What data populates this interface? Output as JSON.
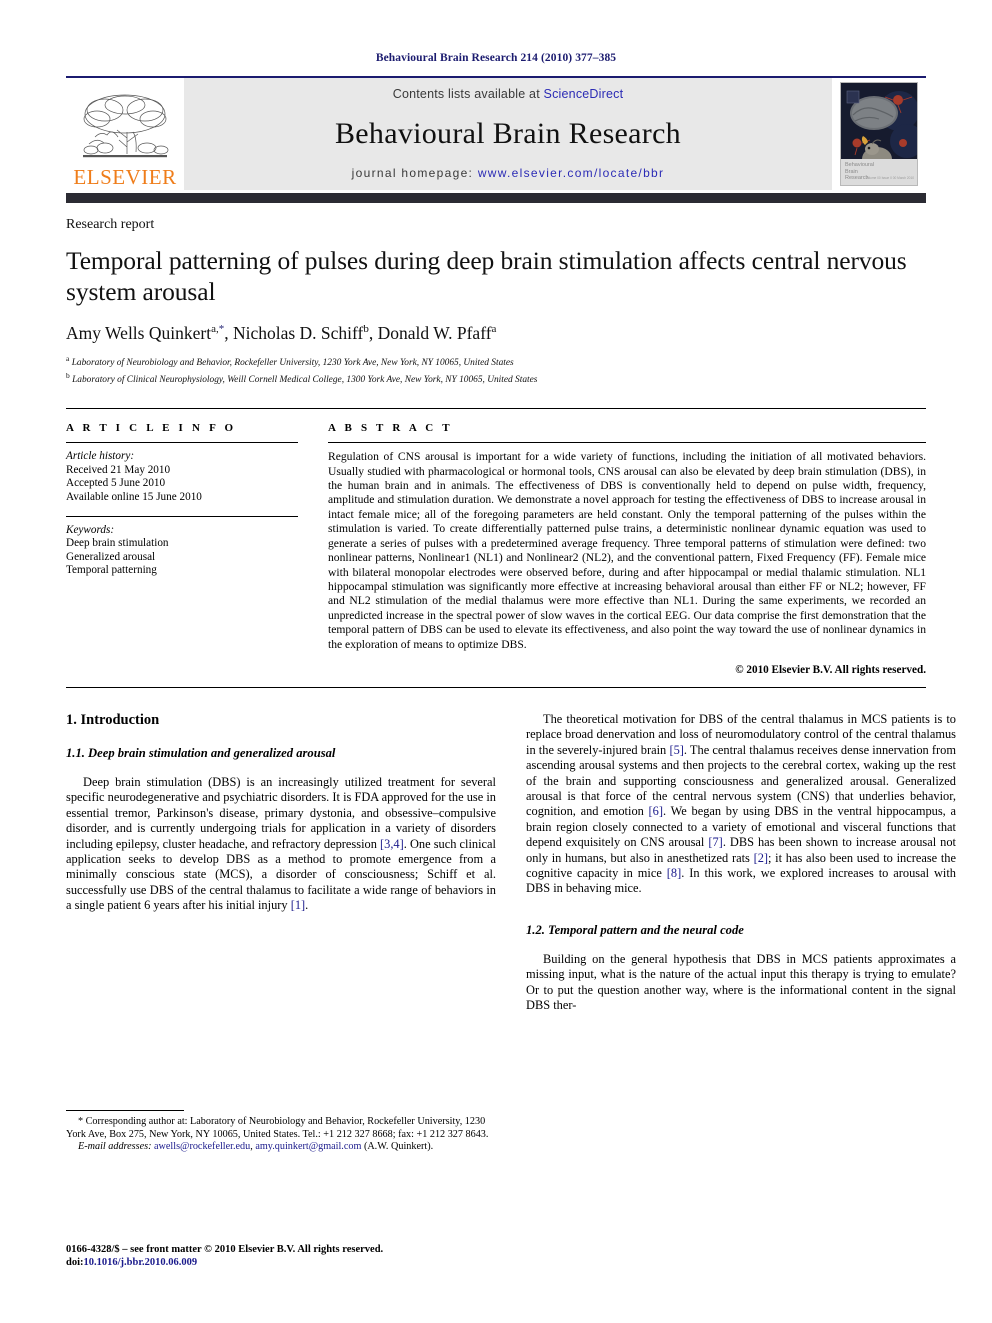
{
  "running_head": "Behavioural Brain Research 214 (2010) 377–385",
  "masthead": {
    "publisher": "ELSEVIER",
    "contents_prefix": "Contents lists available at ",
    "contents_link": "ScienceDirect",
    "journal_title": "Behavioural Brain Research",
    "homepage_prefix": "journal homepage: ",
    "homepage_url": "www.elsevier.com/locate/bbr",
    "cover_caption_line1": "Behavioural",
    "cover_caption_line2": "Brain",
    "cover_caption_line3": "Research",
    "cover_caption_tiny": "Volume 00  Issue 0  00 March 2010",
    "brand_orange": "#ef7d1a",
    "brand_navy": "#1b1b6f"
  },
  "article": {
    "kicker": "Research report",
    "title": "Temporal patterning of pulses during deep brain stimulation affects central nervous system arousal",
    "authors_html": "Amy Wells Quinkert<sup>a,<span class=\"star\">*</span></sup>, Nicholas D. Schiff<sup>b</sup>, Donald W. Pfaff<sup>a</sup>",
    "affiliations": [
      {
        "marker": "a",
        "text": "Laboratory of Neurobiology and Behavior, Rockefeller University, 1230 York Ave, New York, NY 10065, United States"
      },
      {
        "marker": "b",
        "text": "Laboratory of Clinical Neurophysiology, Weill Cornell Medical College, 1300 York Ave, New York, NY 10065, United States"
      }
    ]
  },
  "article_info": {
    "label": "A R T I C L E    I N F O",
    "history_heading": "Article history:",
    "history": [
      "Received 21 May 2010",
      "Accepted 5 June 2010",
      "Available online 15 June 2010"
    ],
    "keywords_heading": "Keywords:",
    "keywords": [
      "Deep brain stimulation",
      "Generalized arousal",
      "Temporal patterning"
    ]
  },
  "abstract": {
    "label": "A B S T R A C T",
    "text": "Regulation of CNS arousal is important for a wide variety of functions, including the initiation of all motivated behaviors. Usually studied with pharmacological or hormonal tools, CNS arousal can also be elevated by deep brain stimulation (DBS), in the human brain and in animals. The effectiveness of DBS is conventionally held to depend on pulse width, frequency, amplitude and stimulation duration. We demonstrate a novel approach for testing the effectiveness of DBS to increase arousal in intact female mice; all of the foregoing parameters are held constant. Only the temporal patterning of the pulses within the stimulation is varied. To create differentially patterned pulse trains, a deterministic nonlinear dynamic equation was used to generate a series of pulses with a predetermined average frequency. Three temporal patterns of stimulation were defined: two nonlinear patterns, Nonlinear1 (NL1) and Nonlinear2 (NL2), and the conventional pattern, Fixed Frequency (FF). Female mice with bilateral monopolar electrodes were observed before, during and after hippocampal or medial thalamic stimulation. NL1 hippocampal stimulation was significantly more effective at increasing behavioral arousal than either FF or NL2; however, FF and NL2 stimulation of the medial thalamus were more effective than NL1. During the same experiments, we recorded an unpredicted increase in the spectral power of slow waves in the cortical EEG. Our data comprise the first demonstration that the temporal pattern of DBS can be used to elevate its effectiveness, and also point the way toward the use of nonlinear dynamics in the exploration of means to optimize DBS.",
    "copyright": "© 2010 Elsevier B.V. All rights reserved."
  },
  "body": {
    "left": {
      "h1": "1.  Introduction",
      "h2": "1.1.  Deep brain stimulation and generalized arousal",
      "para_1a": "Deep brain stimulation (DBS) is an increasingly utilized treatment for several specific neurodegenerative and psychiatric disorders. It is FDA approved for the use in essential tremor, Parkinson's disease, primary dystonia, and obsessive–compulsive disorder, and is currently undergoing trials for application in a variety of disorders including epilepsy, cluster headache, and refractory depression ",
      "ref_34": "[3,4]",
      "para_1b": ". One such clinical application seeks to develop DBS as a method to promote emergence from a minimally conscious state (MCS), a disorder of consciousness; Schiff et al. successfully use DBS of the central thalamus to facilitate a wide range of behaviors in a single patient 6 years after his initial injury ",
      "ref_1": "[1]",
      "para_1c": "."
    },
    "right": {
      "para_2a": "The theoretical motivation for DBS of the central thalamus in MCS patients is to replace broad denervation and loss of neuromodulatory control of the central thalamus in the severely-injured brain ",
      "ref_5": "[5]",
      "para_2b": ". The central thalamus receives dense innervation from ascending arousal systems and then projects to the cerebral cortex, waking up the rest of the brain and supporting consciousness and generalized arousal. Generalized arousal is that force of the central nervous system (CNS) that underlies behavior, cognition, and emotion ",
      "ref_6": "[6]",
      "para_2c": ". We began by using DBS in the ventral hippocampus, a brain region closely connected to a variety of emotional and visceral functions that depend exquisitely on CNS arousal ",
      "ref_7": "[7]",
      "para_2d": ". DBS has been shown to increase arousal not only in humans, but also in anesthetized rats ",
      "ref_2": "[2]",
      "para_2e": "; it has also been used to increase the cognitive capacity in mice ",
      "ref_8": "[8]",
      "para_2f": ". In this work, we explored increases to arousal with DBS in behaving mice.",
      "h2": "1.2.  Temporal pattern and the neural code",
      "para_3": "Building on the general hypothesis that DBS in MCS patients approximates a missing input, what is the nature of the actual input this therapy is trying to emulate? Or to put the question another way, where is the informational content in the signal DBS ther-"
    }
  },
  "footnote": {
    "star": "*",
    "corresponding": " Corresponding author at: Laboratory of Neurobiology and Behavior, Rockefeller University, 1230 York Ave, Box 275, New York, NY 10065, United States.",
    "tel": "Tel.: +1 212 327 8668; fax: +1 212 327 8643.",
    "email_label": "E-mail addresses:",
    "email_1": "awells@rockefeller.edu",
    "email_sep": ", ",
    "email_2": "amy.quinkert@gmail.com",
    "email_owner": "(A.W. Quinkert)."
  },
  "imprint": {
    "line1": "0166-4328/$ – see front matter © 2010 Elsevier B.V. All rights reserved.",
    "doi_label": "doi:",
    "doi_value": "10.1016/j.bbr.2010.06.009"
  }
}
